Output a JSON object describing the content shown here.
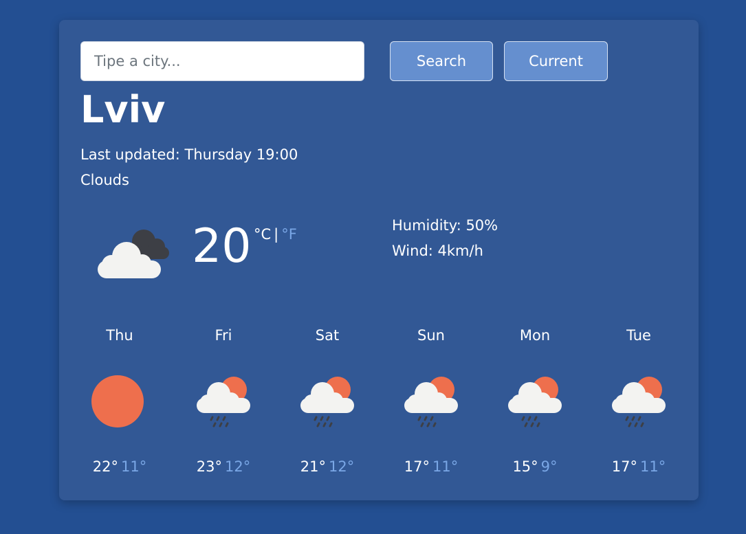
{
  "search": {
    "placeholder": "Tipe a city...",
    "value": "",
    "search_label": "Search",
    "current_label": "Current"
  },
  "weather": {
    "city": "Lviv",
    "last_updated": "Last updated: Thursday 19:00",
    "description": "Clouds",
    "temperature": "20",
    "unit_c": "°C",
    "unit_sep": "|",
    "unit_f": "°F",
    "humidity": "Humidity: 50%",
    "wind": "Wind: 4km/h",
    "icon": "cloudy-icon"
  },
  "forecast": [
    {
      "day": "Thu",
      "max": "22°",
      "min": "11°",
      "icon": "sun-icon"
    },
    {
      "day": "Fri",
      "max": "23°",
      "min": "12°",
      "icon": "rain-sun-icon"
    },
    {
      "day": "Sat",
      "max": "21°",
      "min": "12°",
      "icon": "rain-sun-icon"
    },
    {
      "day": "Sun",
      "max": "17°",
      "min": "11°",
      "icon": "rain-sun-icon"
    },
    {
      "day": "Mon",
      "max": "15°",
      "min": "9°",
      "icon": "rain-sun-icon"
    },
    {
      "day": "Tue",
      "max": "17°",
      "min": "11°",
      "icon": "rain-sun-icon"
    }
  ],
  "colors": {
    "background": "#234f92",
    "card": "#325895",
    "button": "#658fcf",
    "accent_muted": "#7aa7e6",
    "sun": "#ee6f4d"
  }
}
